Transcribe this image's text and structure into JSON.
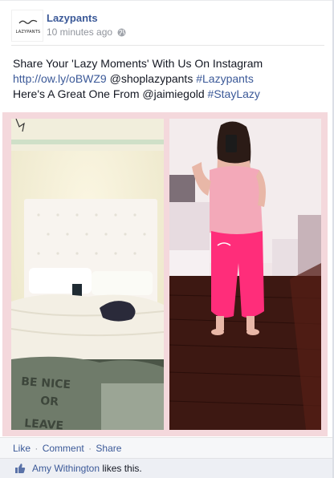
{
  "post": {
    "page_name": "Lazypants",
    "avatar_logo_text": "LAZYPANTS",
    "timestamp": "10 minutes ago",
    "privacy_icon": "globe-icon",
    "text_line1": "Share Your 'Lazy Moments' With Us On Instagram",
    "link_url": "http://ow.ly/oBWZ9",
    "mention1": " @shoplazypants ",
    "hashtag1": "#Lazypants",
    "text_line3_prefix": "Here's A Great One From @jaimiegold ",
    "hashtag2": "#StayLazy"
  },
  "photos": {
    "left_pillow_text": "BE NICE OR LEAVE",
    "colors": {
      "frame": "#f4d8dc",
      "pants": "#ff2d7a",
      "shirt": "#f3a9b9",
      "floor": "#3a1a14"
    }
  },
  "actions": {
    "like": "Like",
    "comment": "Comment",
    "share": "Share",
    "separator": "·"
  },
  "likes": {
    "icon": "thumbs-up-icon",
    "user": "Amy Withington",
    "suffix": " likes this."
  },
  "colors": {
    "link": "#3b5998",
    "meta": "#90949c"
  }
}
